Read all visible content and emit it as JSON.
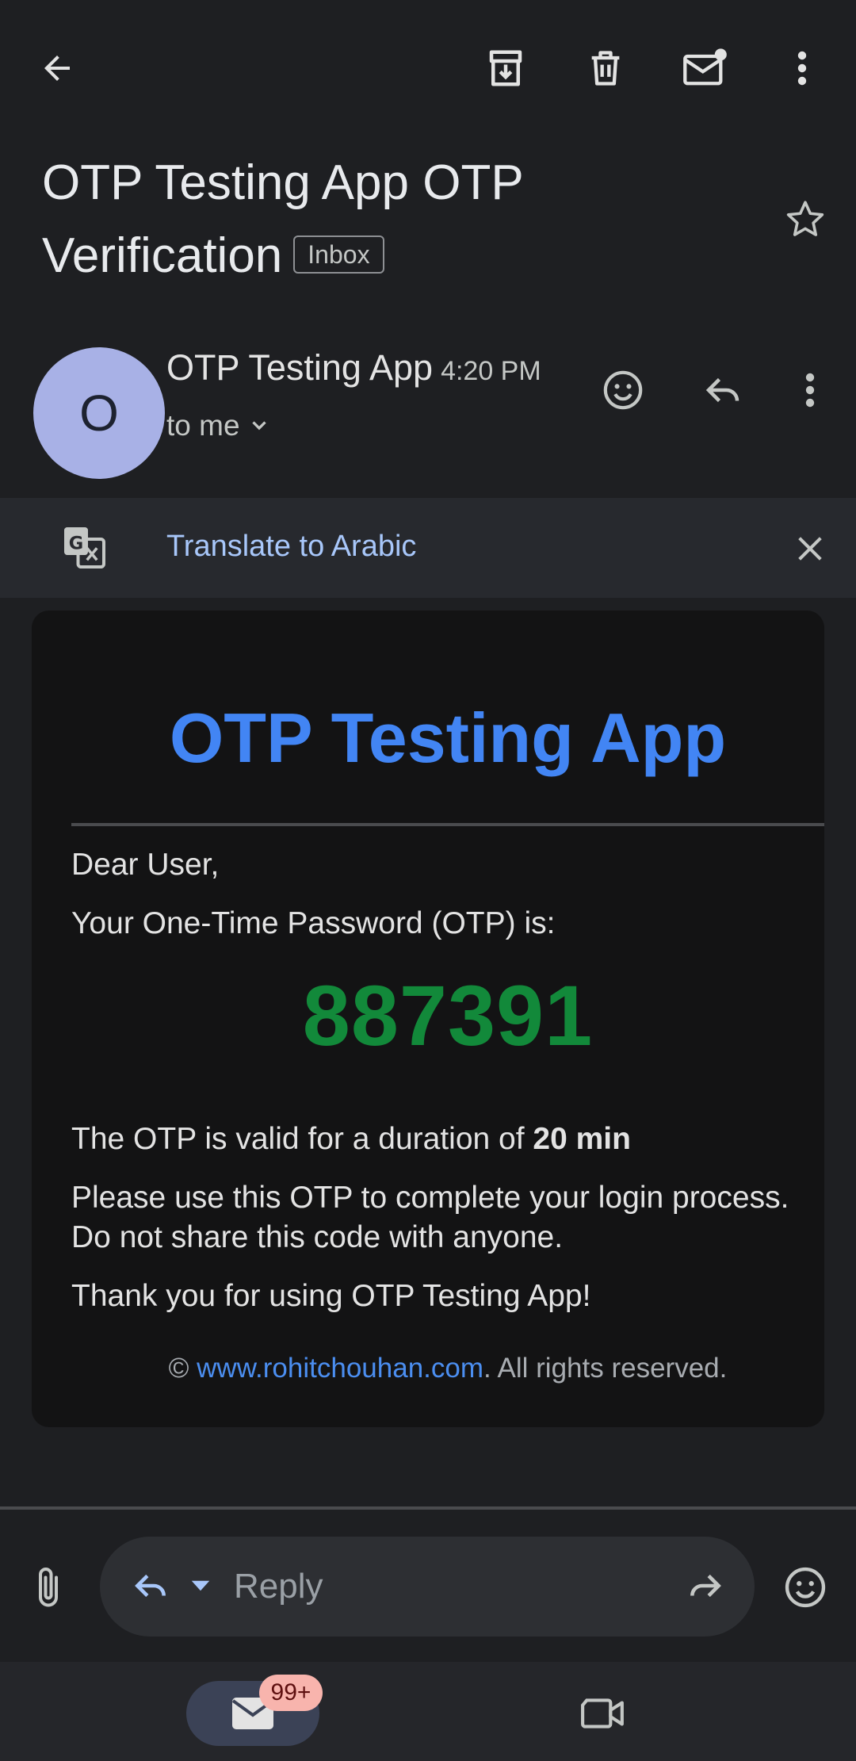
{
  "toolbar": {
    "back_icon": "arrow-left-icon",
    "archive_icon": "archive-icon",
    "delete_icon": "trash-icon",
    "mark_unread_icon": "mail-unread-icon",
    "more_icon": "more-vert-icon"
  },
  "email": {
    "subject": "OTP Testing App OTP Verification",
    "label": "Inbox",
    "starred": false,
    "sender": {
      "avatar_letter": "O",
      "name": "OTP Testing App",
      "time": "4:20 PM",
      "recipient": "to me"
    }
  },
  "translate": {
    "label": "Translate to Arabic"
  },
  "body": {
    "heading": "OTP Testing App",
    "greeting": "Dear User,",
    "intro": "Your One-Time Password (OTP) is:",
    "otp": "887391",
    "validity_prefix": "The OTP is valid for a duration of ",
    "validity_value": "20 min",
    "instructions": "Please use this OTP to complete your login process. Do not share this code with anyone.",
    "thanks": "Thank you for using OTP Testing App!",
    "footer_prefix": "© ",
    "footer_link": "www.rohitchouhan.com",
    "footer_suffix": ". All rights reserved."
  },
  "reply_bar": {
    "placeholder": "Reply"
  },
  "bottom_nav": {
    "mail_badge": "99+"
  },
  "colors": {
    "background": "#1e1f22",
    "accent_blue": "#4285f4",
    "otp_green": "#12893a",
    "link_blue": "#a8c7fa"
  }
}
